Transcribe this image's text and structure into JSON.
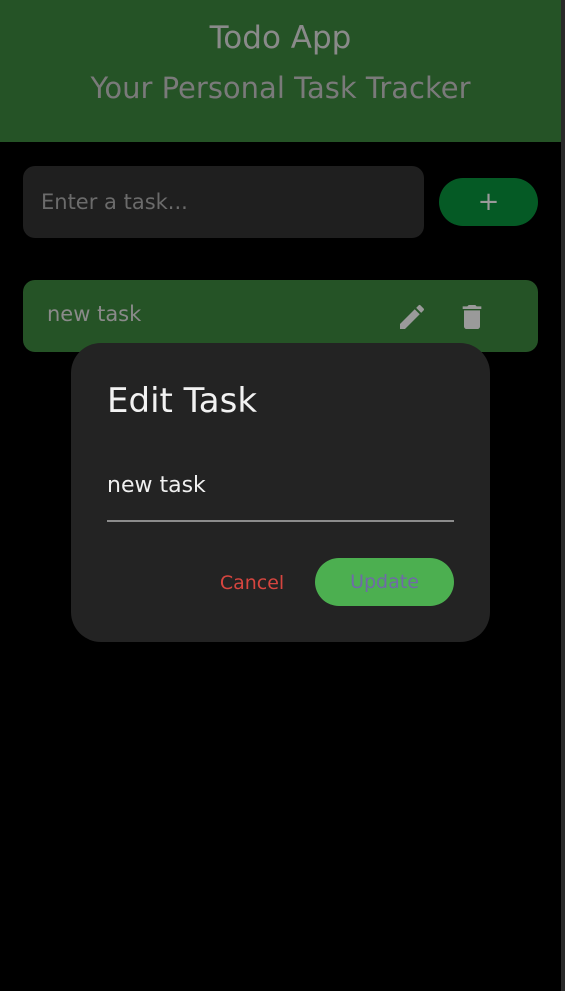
{
  "header": {
    "title": "Todo App",
    "subtitle": "Your Personal Task Tracker"
  },
  "input": {
    "placeholder": "Enter a task...",
    "value": ""
  },
  "add_button": {
    "label": "+",
    "icon": "plus-icon"
  },
  "tasks": [
    {
      "text": "new task",
      "icons": [
        "edit-icon",
        "delete-icon"
      ]
    }
  ],
  "dialog": {
    "title": "Edit Task",
    "field_value": "new task",
    "cancel_label": "Cancel",
    "update_label": "Update"
  },
  "colors": {
    "background": "#000000",
    "header": "#255326",
    "task_item": "#255326",
    "add_button": "#055a25",
    "dialog": "#232323",
    "update_button": "#4caf50",
    "cancel_text": "#d6453f",
    "update_text": "#6f6aa8"
  }
}
